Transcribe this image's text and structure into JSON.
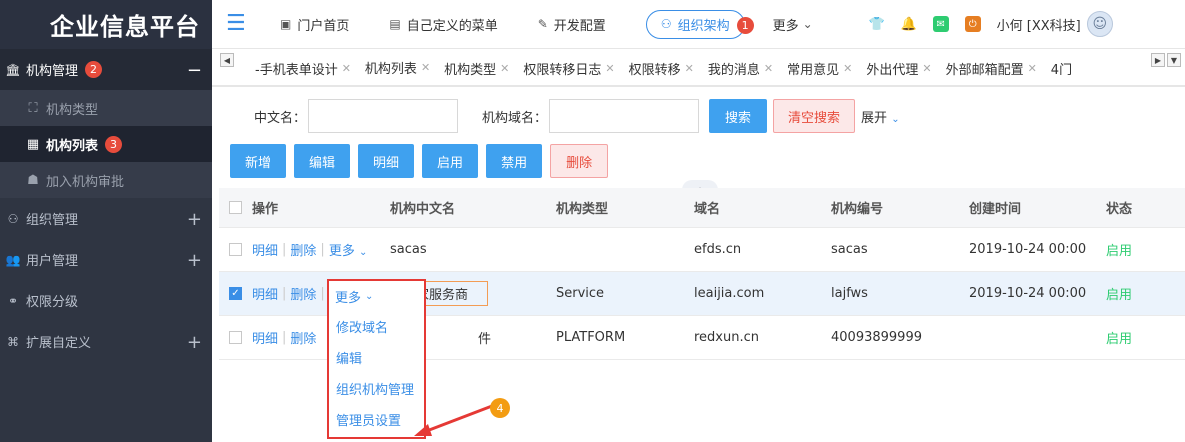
{
  "sidebar": {
    "logo": "企业信息平台",
    "group_active": {
      "label": "机构管理",
      "badge": "2",
      "toggle": "−"
    },
    "sub_items": [
      {
        "label": "机构类型"
      },
      {
        "label": "机构列表",
        "badge": "3"
      },
      {
        "label": "加入机构审批"
      }
    ],
    "groups": [
      {
        "label": "组织管理",
        "toggle": "+"
      },
      {
        "label": "用户管理",
        "toggle": "+"
      },
      {
        "label": "权限分级",
        "toggle": ""
      },
      {
        "label": "扩展自定义",
        "toggle": "+"
      }
    ]
  },
  "topbar": {
    "links": [
      {
        "label": "门户首页"
      },
      {
        "label": "自己定义的菜单"
      },
      {
        "label": "开发配置"
      }
    ],
    "org": {
      "label": "组织架构",
      "badge": "1"
    },
    "more": "更多",
    "user": "小何 [XX科技]"
  },
  "tabs": {
    "items": [
      {
        "label": "-手机表单设计"
      },
      {
        "label": "机构列表",
        "active": true
      },
      {
        "label": "机构类型"
      },
      {
        "label": "权限转移日志"
      },
      {
        "label": "权限转移"
      },
      {
        "label": "我的消息"
      },
      {
        "label": "常用意见"
      },
      {
        "label": "外出代理"
      },
      {
        "label": "外部邮箱配置"
      },
      {
        "label": "4门"
      }
    ]
  },
  "search": {
    "cn_label": "中文名：",
    "domain_label": "机构域名：",
    "search_btn": "搜索",
    "clear_btn": "清空搜索",
    "expand": "展开"
  },
  "toolbar": {
    "add": "新增",
    "edit": "编辑",
    "detail": "明细",
    "enable": "启用",
    "disable": "禁用",
    "delete": "删除"
  },
  "table": {
    "headers": {
      "op": "操作",
      "name": "机构中文名",
      "type": "机构类型",
      "domain": "域名",
      "code": "机构编号",
      "created": "创建时间",
      "status": "状态"
    },
    "op_labels": {
      "detail": "明细",
      "delete": "删除",
      "more": "更多"
    },
    "rows": [
      {
        "name": "sacas",
        "type": "",
        "domain": "efds.cn",
        "code": "sacas",
        "created": "2019-10-24 00:00",
        "status": "启用"
      },
      {
        "name": "乐爱家服务商",
        "type": "Service",
        "domain": "leaijia.com",
        "code": "lajfws",
        "created": "2019-10-24 00:00",
        "status": "启用"
      },
      {
        "name": "件",
        "type": "PLATFORM",
        "domain": "redxun.cn",
        "code": "40093899999",
        "created": "",
        "status": "启用"
      }
    ]
  },
  "dropdown": {
    "head": "更多",
    "items": [
      {
        "label": "修改域名"
      },
      {
        "label": "编辑"
      },
      {
        "label": "组织机构管理"
      },
      {
        "label": "管理员设置"
      }
    ]
  },
  "annotation": {
    "step4": "4"
  },
  "colors": {
    "primary": "#3a8ee6",
    "sidebar": "#2f3542",
    "danger": "#e53935",
    "success": "#2ecc71",
    "annotation": "#f39c12"
  }
}
